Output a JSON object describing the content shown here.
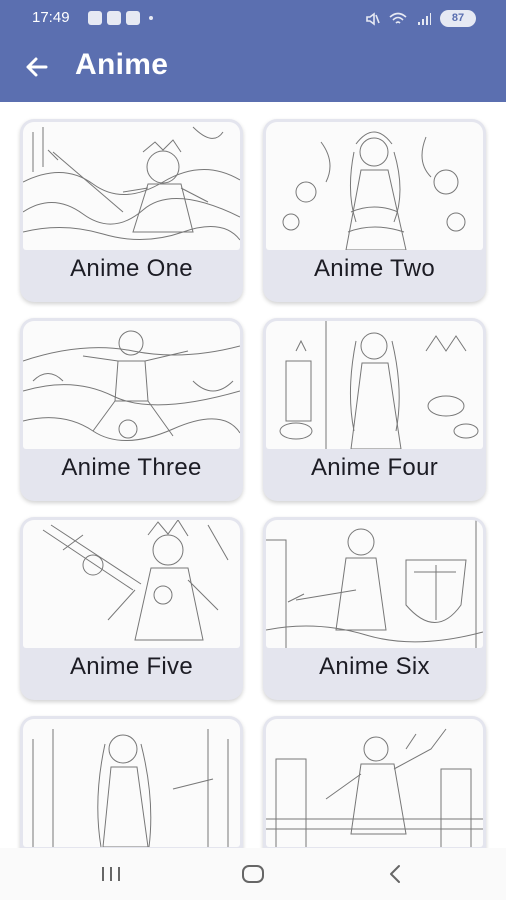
{
  "status_bar": {
    "time": "17:49",
    "battery": "87"
  },
  "header": {
    "title": "Anime",
    "back_icon": "arrow-left-icon"
  },
  "theme": {
    "primary": "#5b6fb0",
    "card_bg": "#e4e5ee"
  },
  "items": [
    {
      "label": "Anime One"
    },
    {
      "label": "Anime Two"
    },
    {
      "label": "Anime Three"
    },
    {
      "label": "Anime Four"
    },
    {
      "label": "Anime Five"
    },
    {
      "label": "Anime Six"
    },
    {
      "label": ""
    },
    {
      "label": ""
    }
  ],
  "nav": {
    "recents_icon": "recents-icon",
    "home_icon": "home-icon",
    "back_icon": "back-icon"
  }
}
